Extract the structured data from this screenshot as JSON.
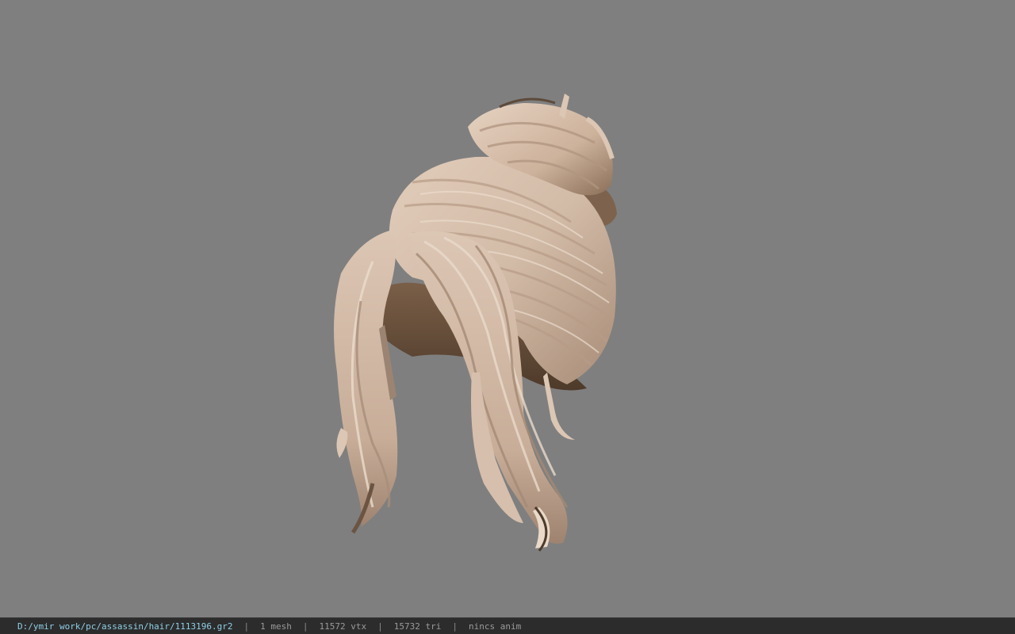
{
  "status_bar": {
    "file_path": "D:/ymir work/pc/assassin/hair/1113196.gr2",
    "separator": "|",
    "mesh_count": "1 mesh",
    "vertex_count": "11572 vtx",
    "triangle_count": "15732 tri",
    "anim_status": "nincs anim"
  },
  "colors": {
    "viewport_background": "#7f7f7f",
    "statusbar_background": "#2c2c2c",
    "path_text": "#8fd0e6",
    "hair_light": "#dcc6b4",
    "hair_mid": "#c4ab96",
    "hair_dark": "#6e5640"
  },
  "viewport": {
    "model_icon": "hair-model-3d"
  }
}
